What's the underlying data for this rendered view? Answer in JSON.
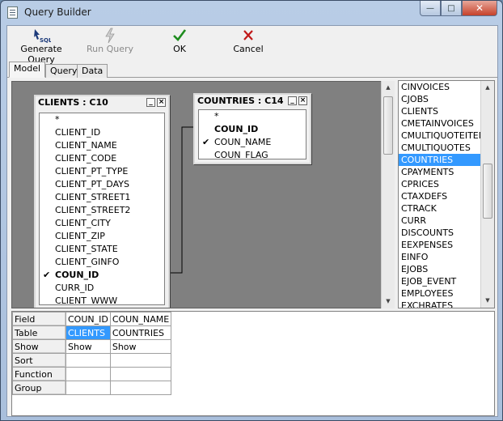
{
  "window": {
    "title": "Query Builder"
  },
  "toolbar": {
    "generate_query": "Generate Query",
    "run_query": "Run Query",
    "ok": "OK",
    "cancel": "Cancel",
    "sql_badge": "SQL"
  },
  "tabs": [
    "Model",
    "Query",
    "Data"
  ],
  "active_tab": "Model",
  "clients_table": {
    "title": "CLIENTS : C10",
    "fields": [
      {
        "name": "*",
        "bold": false,
        "checked": false
      },
      {
        "name": "CLIENT_ID",
        "bold": false,
        "checked": false
      },
      {
        "name": "CLIENT_NAME",
        "bold": false,
        "checked": false
      },
      {
        "name": "CLIENT_CODE",
        "bold": false,
        "checked": false
      },
      {
        "name": "CLIENT_PT_TYPE",
        "bold": false,
        "checked": false
      },
      {
        "name": "CLIENT_PT_DAYS",
        "bold": false,
        "checked": false
      },
      {
        "name": "CLIENT_STREET1",
        "bold": false,
        "checked": false
      },
      {
        "name": "CLIENT_STREET2",
        "bold": false,
        "checked": false
      },
      {
        "name": "CLIENT_CITY",
        "bold": false,
        "checked": false
      },
      {
        "name": "CLIENT_ZIP",
        "bold": false,
        "checked": false
      },
      {
        "name": "CLIENT_STATE",
        "bold": false,
        "checked": false
      },
      {
        "name": "CLIENT_GINFO",
        "bold": false,
        "checked": false
      },
      {
        "name": "COUN_ID",
        "bold": true,
        "checked": true
      },
      {
        "name": "CURR_ID",
        "bold": false,
        "checked": false
      },
      {
        "name": "CLIENT_WWW",
        "bold": false,
        "checked": false
      }
    ]
  },
  "countries_table": {
    "title": "COUNTRIES : C14",
    "fields": [
      {
        "name": "*",
        "bold": false,
        "checked": false
      },
      {
        "name": "COUN_ID",
        "bold": true,
        "checked": false
      },
      {
        "name": "COUN_NAME",
        "bold": false,
        "checked": true
      },
      {
        "name": "COUN_FLAG",
        "bold": false,
        "checked": false
      }
    ]
  },
  "table_list": {
    "items": [
      "CINVOICES",
      "CJOBS",
      "CLIENTS",
      "CMETAINVOICES",
      "CMULTIQUOTEITEMS",
      "CMULTIQUOTES",
      "COUNTRIES",
      "CPAYMENTS",
      "CPRICES",
      "CTAXDEFS",
      "CTRACK",
      "CURR",
      "DISCOUNTS",
      "EEXPENSES",
      "EINFO",
      "EJOBS",
      "EJOB_EVENT",
      "EMPLOYEES",
      "EXCHRATES"
    ],
    "selected": "COUNTRIES"
  },
  "grid": {
    "row_headers": [
      "Field",
      "Table",
      "Show",
      "Sort",
      "Function",
      "Group"
    ],
    "columns": [
      {
        "Field": "COUN_ID",
        "Table": "CLIENTS",
        "Show": "Show",
        "Sort": "",
        "Function": "",
        "Group": ""
      },
      {
        "Field": "COUN_NAME",
        "Table": "COUNTRIES",
        "Show": "Show",
        "Sort": "",
        "Function": "",
        "Group": ""
      }
    ]
  },
  "icons": {
    "generate": "sql-generate-icon",
    "run": "lightning-icon",
    "ok": "checkmark-icon",
    "cancel": "x-icon"
  },
  "colors": {
    "selection": "#3399ff",
    "ok_green": "#1e8c1e",
    "cancel_red": "#c01818",
    "canvas": "#808080"
  }
}
